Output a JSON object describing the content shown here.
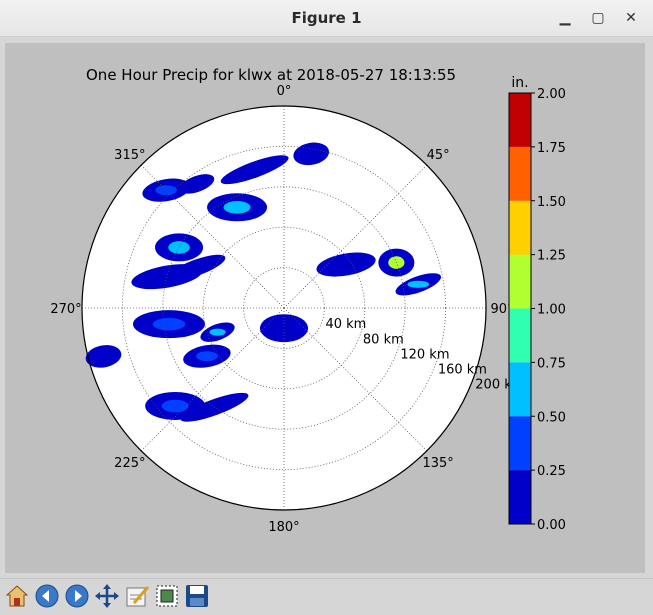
{
  "window": {
    "title": "Figure 1",
    "minimize_glyph": "▁",
    "maximize_glyph": "▢",
    "close_glyph": "✕"
  },
  "chart_data": {
    "type": "polar-radar",
    "title": "One Hour Precip for klwx at 2018-05-27 18:13:55",
    "angle_ticks": [
      "0°",
      "45°",
      "90°",
      "135°",
      "180°",
      "225°",
      "270°",
      "315°"
    ],
    "radial_ticks": [
      "40 km",
      "80 km",
      "120 km",
      "160 km",
      "200 km"
    ],
    "radial_max_km": 200,
    "colorbar": {
      "unit": "in.",
      "ticks": [
        "0.00",
        "0.25",
        "0.50",
        "0.75",
        "1.00",
        "1.25",
        "1.50",
        "1.75",
        "2.00"
      ],
      "colors": [
        "#0000c8",
        "#0040ff",
        "#00c0ff",
        "#30ffb0",
        "#b0ff30",
        "#ffd000",
        "#ff6000",
        "#c00000"
      ]
    },
    "precip_regions": [
      {
        "angle": 325,
        "r": 150,
        "level": 0
      },
      {
        "angle": 315,
        "r": 165,
        "level": 1
      },
      {
        "angle": 335,
        "r": 110,
        "level": 2
      },
      {
        "angle": 348,
        "r": 140,
        "level": 0
      },
      {
        "angle": 10,
        "r": 155,
        "level": 0
      },
      {
        "angle": 300,
        "r": 120,
        "level": 2
      },
      {
        "angle": 295,
        "r": 95,
        "level": 0
      },
      {
        "angle": 285,
        "r": 120,
        "level": 0
      },
      {
        "angle": 68,
        "r": 120,
        "level": 4
      },
      {
        "angle": 80,
        "r": 135,
        "level": 2
      },
      {
        "angle": 55,
        "r": 75,
        "level": 0
      },
      {
        "angle": 262,
        "r": 115,
        "level": 1
      },
      {
        "angle": 250,
        "r": 70,
        "level": 2
      },
      {
        "angle": 238,
        "r": 90,
        "level": 1
      },
      {
        "angle": 228,
        "r": 145,
        "level": 1
      },
      {
        "angle": 215,
        "r": 120,
        "level": 0
      },
      {
        "angle": 255,
        "r": 185,
        "level": 0
      },
      {
        "angle": 180,
        "r": 20,
        "level": 0
      }
    ]
  },
  "toolbar": {
    "home": "home-icon",
    "back": "back-icon",
    "forward": "forward-icon",
    "pan": "pan-icon",
    "configure": "configure-icon",
    "zoom": "zoom-icon",
    "save": "save-icon"
  }
}
